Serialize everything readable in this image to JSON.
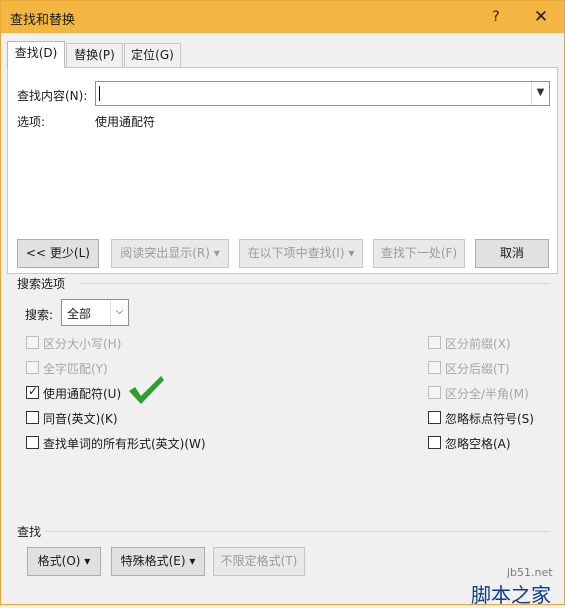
{
  "window": {
    "title": "查找和替换",
    "help": "?",
    "close": "✕"
  },
  "tabs": [
    {
      "label": "查找(D)"
    },
    {
      "label": "替换(P)"
    },
    {
      "label": "定位(G)"
    }
  ],
  "find": {
    "label": "查找内容(N):",
    "value": ""
  },
  "options_summary": {
    "label": "选项:",
    "value": "使用通配符"
  },
  "buttons": {
    "less": "<< 更少(L)",
    "reading_highlight": "阅读突出显示(R) ▾",
    "find_in": "在以下项中查找(I) ▾",
    "find_next": "查找下一处(F)",
    "cancel": "取消"
  },
  "search_options": {
    "section_title": "搜索选项",
    "search_label": "搜索:",
    "search_value": "全部"
  },
  "checkboxes_left": [
    {
      "label": "区分大小写(H)",
      "checked": false,
      "disabled": true
    },
    {
      "label": "全字匹配(Y)",
      "checked": false,
      "disabled": true
    },
    {
      "label": "使用通配符(U)",
      "checked": true,
      "disabled": false
    },
    {
      "label": "同音(英文)(K)",
      "checked": false,
      "disabled": false
    },
    {
      "label": "查找单词的所有形式(英文)(W)",
      "checked": false,
      "disabled": false
    }
  ],
  "checkboxes_right": [
    {
      "label": "区分前缀(X)",
      "checked": false,
      "disabled": true
    },
    {
      "label": "区分后缀(T)",
      "checked": false,
      "disabled": true
    },
    {
      "label": "区分全/半角(M)",
      "checked": false,
      "disabled": true
    },
    {
      "label": "忽略标点符号(S)",
      "checked": false,
      "disabled": false
    },
    {
      "label": "忽略空格(A)",
      "checked": false,
      "disabled": false
    }
  ],
  "find_section": {
    "title": "查找",
    "format": "格式(O) ▾",
    "special": "特殊格式(E) ▾",
    "no_format": "不限定格式(T)"
  },
  "watermark": {
    "site": "jb51.net",
    "brand": "脚本之家"
  },
  "colors": {
    "titlebar": "#f4b642",
    "check_green": "#2e9e2e"
  }
}
